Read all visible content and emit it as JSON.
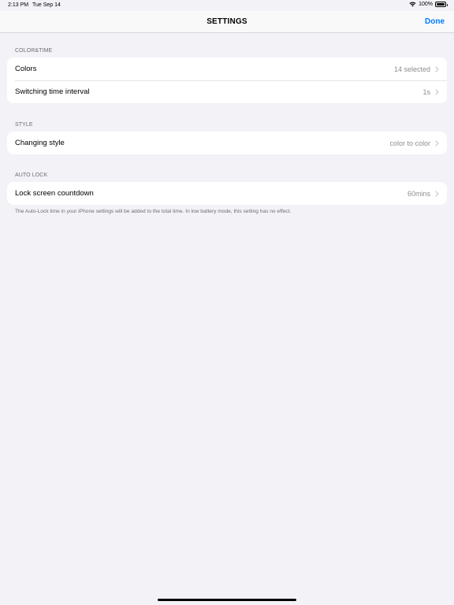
{
  "status_bar": {
    "time": "2:13 PM",
    "date": "Tue Sep 14",
    "battery": "100%"
  },
  "nav": {
    "title": "SETTINGS",
    "done_label": "Done"
  },
  "sections": [
    {
      "header": "COLOR&TIME",
      "rows": [
        {
          "label": "Colors",
          "value": "14 selected"
        },
        {
          "label": "Switching time interval",
          "value": "1s"
        }
      ]
    },
    {
      "header": "STYLE",
      "rows": [
        {
          "label": "Changing style",
          "value": "color to color"
        }
      ]
    },
    {
      "header": "AUTO LOCK",
      "rows": [
        {
          "label": "Lock screen countdown",
          "value": "60mins"
        }
      ],
      "footer": "The Auto-Lock time in your iPhone settings will be added to the total time. In low battery mode, this setting has no effect."
    }
  ],
  "colors": {
    "accent": "#007aff",
    "background": "#f2f2f7",
    "secondary_text": "#8e8e93"
  },
  "icons": [
    "wifi-icon",
    "battery-icon",
    "chevron-right-icon"
  ]
}
